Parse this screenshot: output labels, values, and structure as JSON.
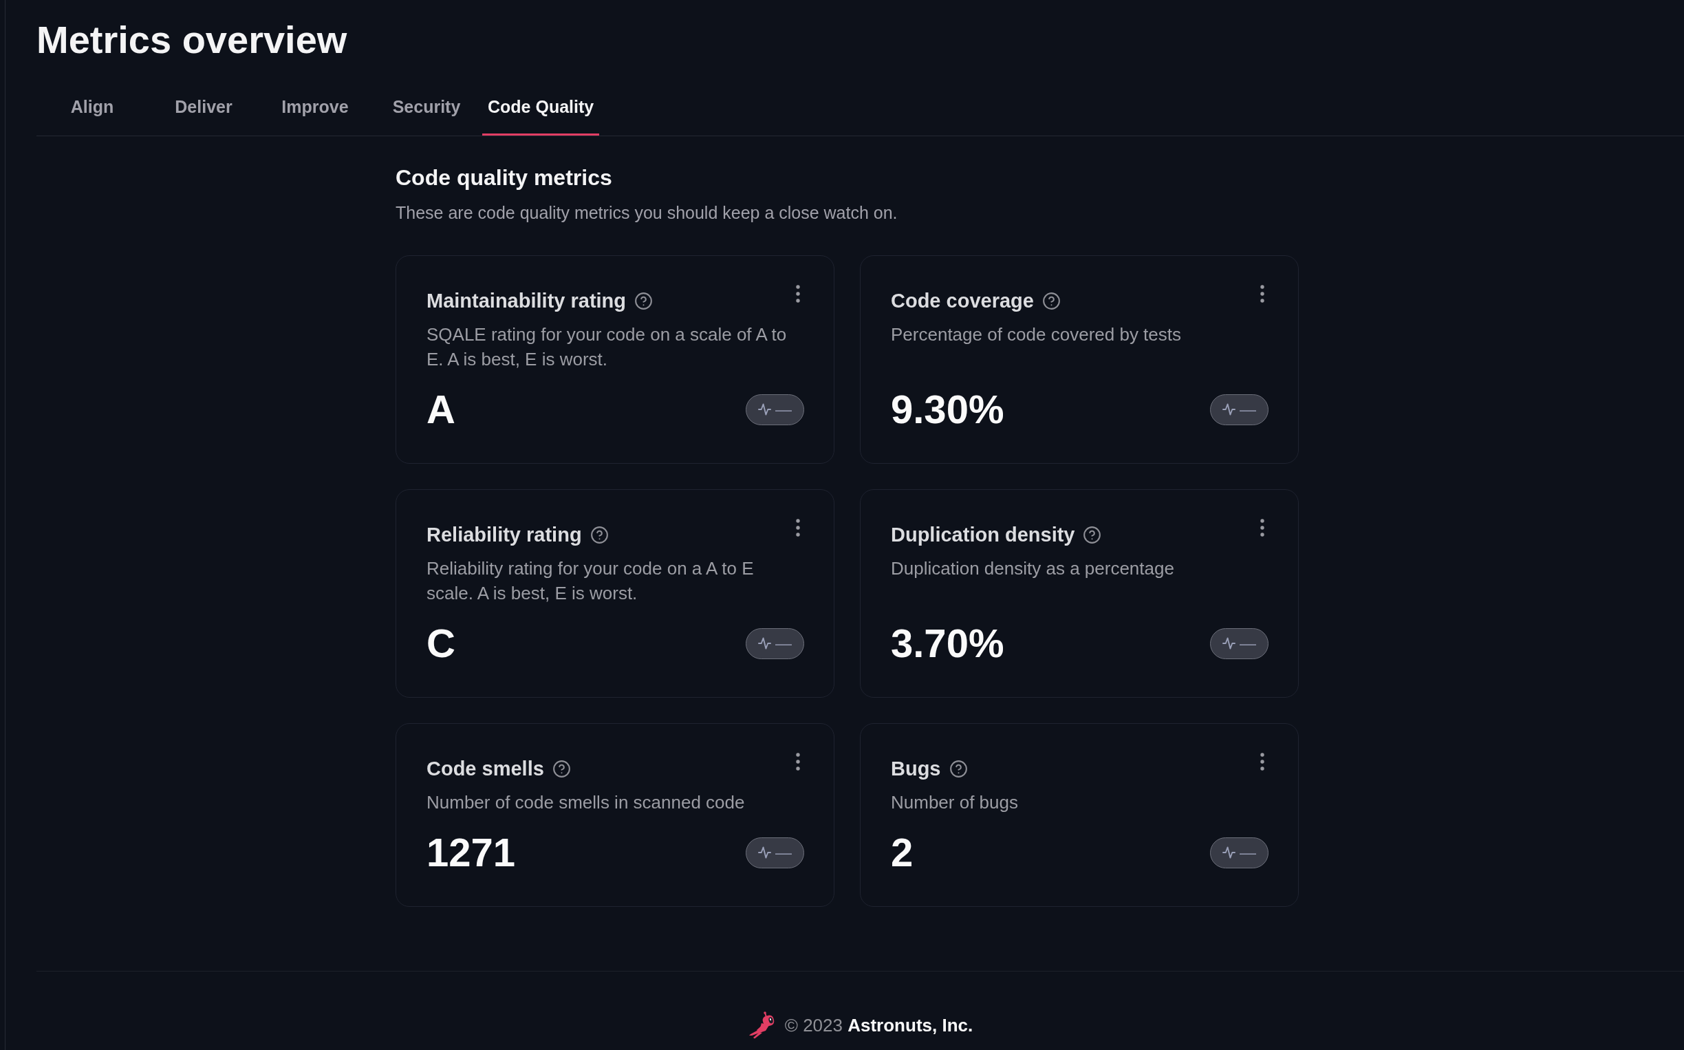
{
  "page": {
    "title": "Metrics overview"
  },
  "tabs": [
    {
      "label": "Align",
      "selected": false
    },
    {
      "label": "Deliver",
      "selected": false
    },
    {
      "label": "Improve",
      "selected": false
    },
    {
      "label": "Security",
      "selected": false
    },
    {
      "label": "Code Quality",
      "selected": true
    }
  ],
  "section": {
    "title": "Code quality metrics",
    "subtitle": "These are code quality metrics you should keep a close watch on."
  },
  "metrics": [
    {
      "title": "Maintainability rating",
      "description": "SQALE rating for your code on a scale of A to E. A is best, E is worst.",
      "value": "A",
      "trend": "—"
    },
    {
      "title": "Code coverage",
      "description": "Percentage of code covered by tests",
      "value": "9.30%",
      "trend": "—"
    },
    {
      "title": "Reliability rating",
      "description": "Reliability rating for your code on a A to E scale. A is best, E is worst.",
      "value": "C",
      "trend": "—"
    },
    {
      "title": "Duplication density",
      "description": "Duplication density as a percentage",
      "value": "3.70%",
      "trend": "—"
    },
    {
      "title": "Code smells",
      "description": "Number of code smells in scanned code",
      "value": "1271",
      "trend": "—"
    },
    {
      "title": "Bugs",
      "description": "Number of bugs",
      "value": "2",
      "trend": "—"
    }
  ],
  "footer": {
    "text": "© 2023 **Astronuts, Inc.**"
  }
}
